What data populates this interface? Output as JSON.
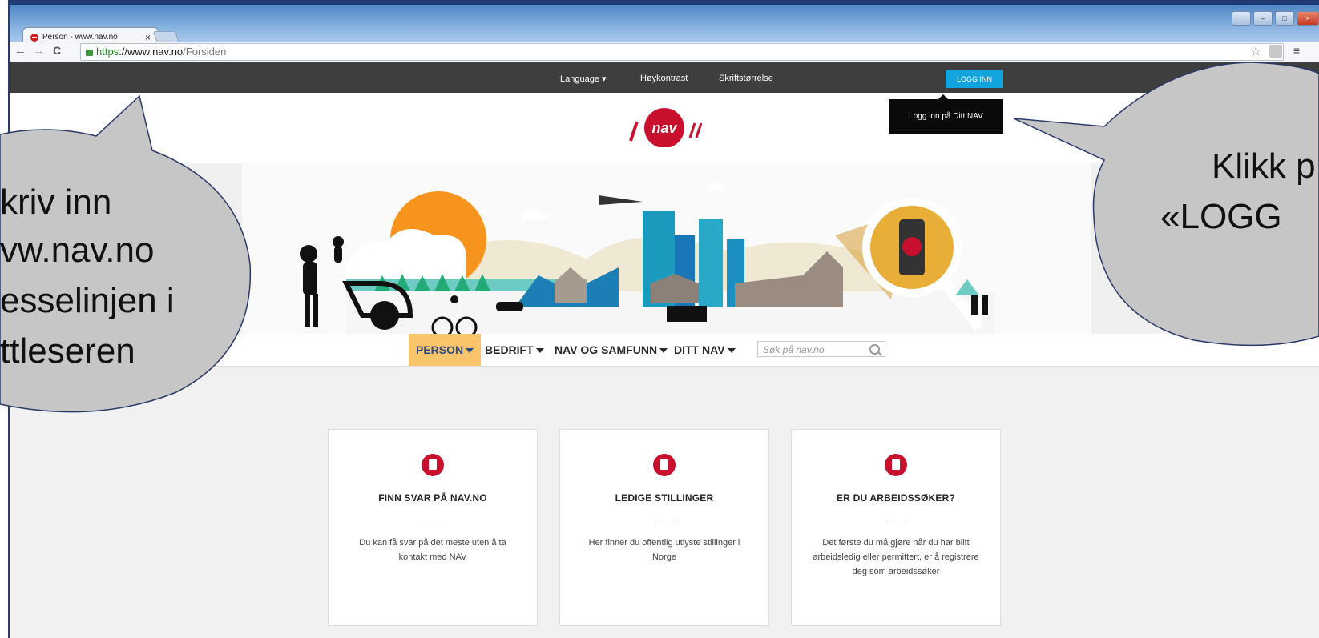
{
  "browser": {
    "tab_title": "Person - www.nav.no",
    "tab_close": "×",
    "url_https": "https",
    "url_host": "://www.nav.no",
    "url_path": "/Forsiden",
    "back_icon": "←",
    "forward_icon": "→",
    "reload_icon": "C",
    "star_icon": "☆",
    "menu_icon": "≡"
  },
  "topbar": {
    "language": "Language ▾",
    "contrast": "Høykontrast",
    "fontsize": "Skriftstørrelse",
    "login": "LOGG INN",
    "tooltip": "Logg inn på Ditt NAV"
  },
  "logo": {
    "text": "nav"
  },
  "nav": {
    "items": [
      "PERSON",
      "BEDRIFT",
      "NAV OG SAMFUNN",
      "DITT NAV"
    ],
    "search_placeholder": "Søk på nav.no"
  },
  "cards": [
    {
      "title": "FINN SVAR PÅ NAV.NO",
      "text": "Du kan få svar på det meste uten å ta kontakt med NAV"
    },
    {
      "title": "LEDIGE STILLINGER",
      "text": "Her finner du offentlig utlyste stillinger i Norge"
    },
    {
      "title": "ER DU ARBEIDSSØKER?",
      "text": "Det første du må gjøre når du har blitt arbeidsledig eller permittert, er å registrere deg som arbeidssøker"
    }
  ],
  "bubbles": {
    "left": [
      "kriv inn",
      "vw.nav.no",
      "esselinjen i",
      "ttleseren"
    ],
    "right": [
      "Klikk p",
      "«LOGG"
    ]
  },
  "colors": {
    "accent": "#c8102e",
    "topbar": "#3e3e3e",
    "login": "#12a4dd",
    "active_nav": "#f9c46a"
  }
}
